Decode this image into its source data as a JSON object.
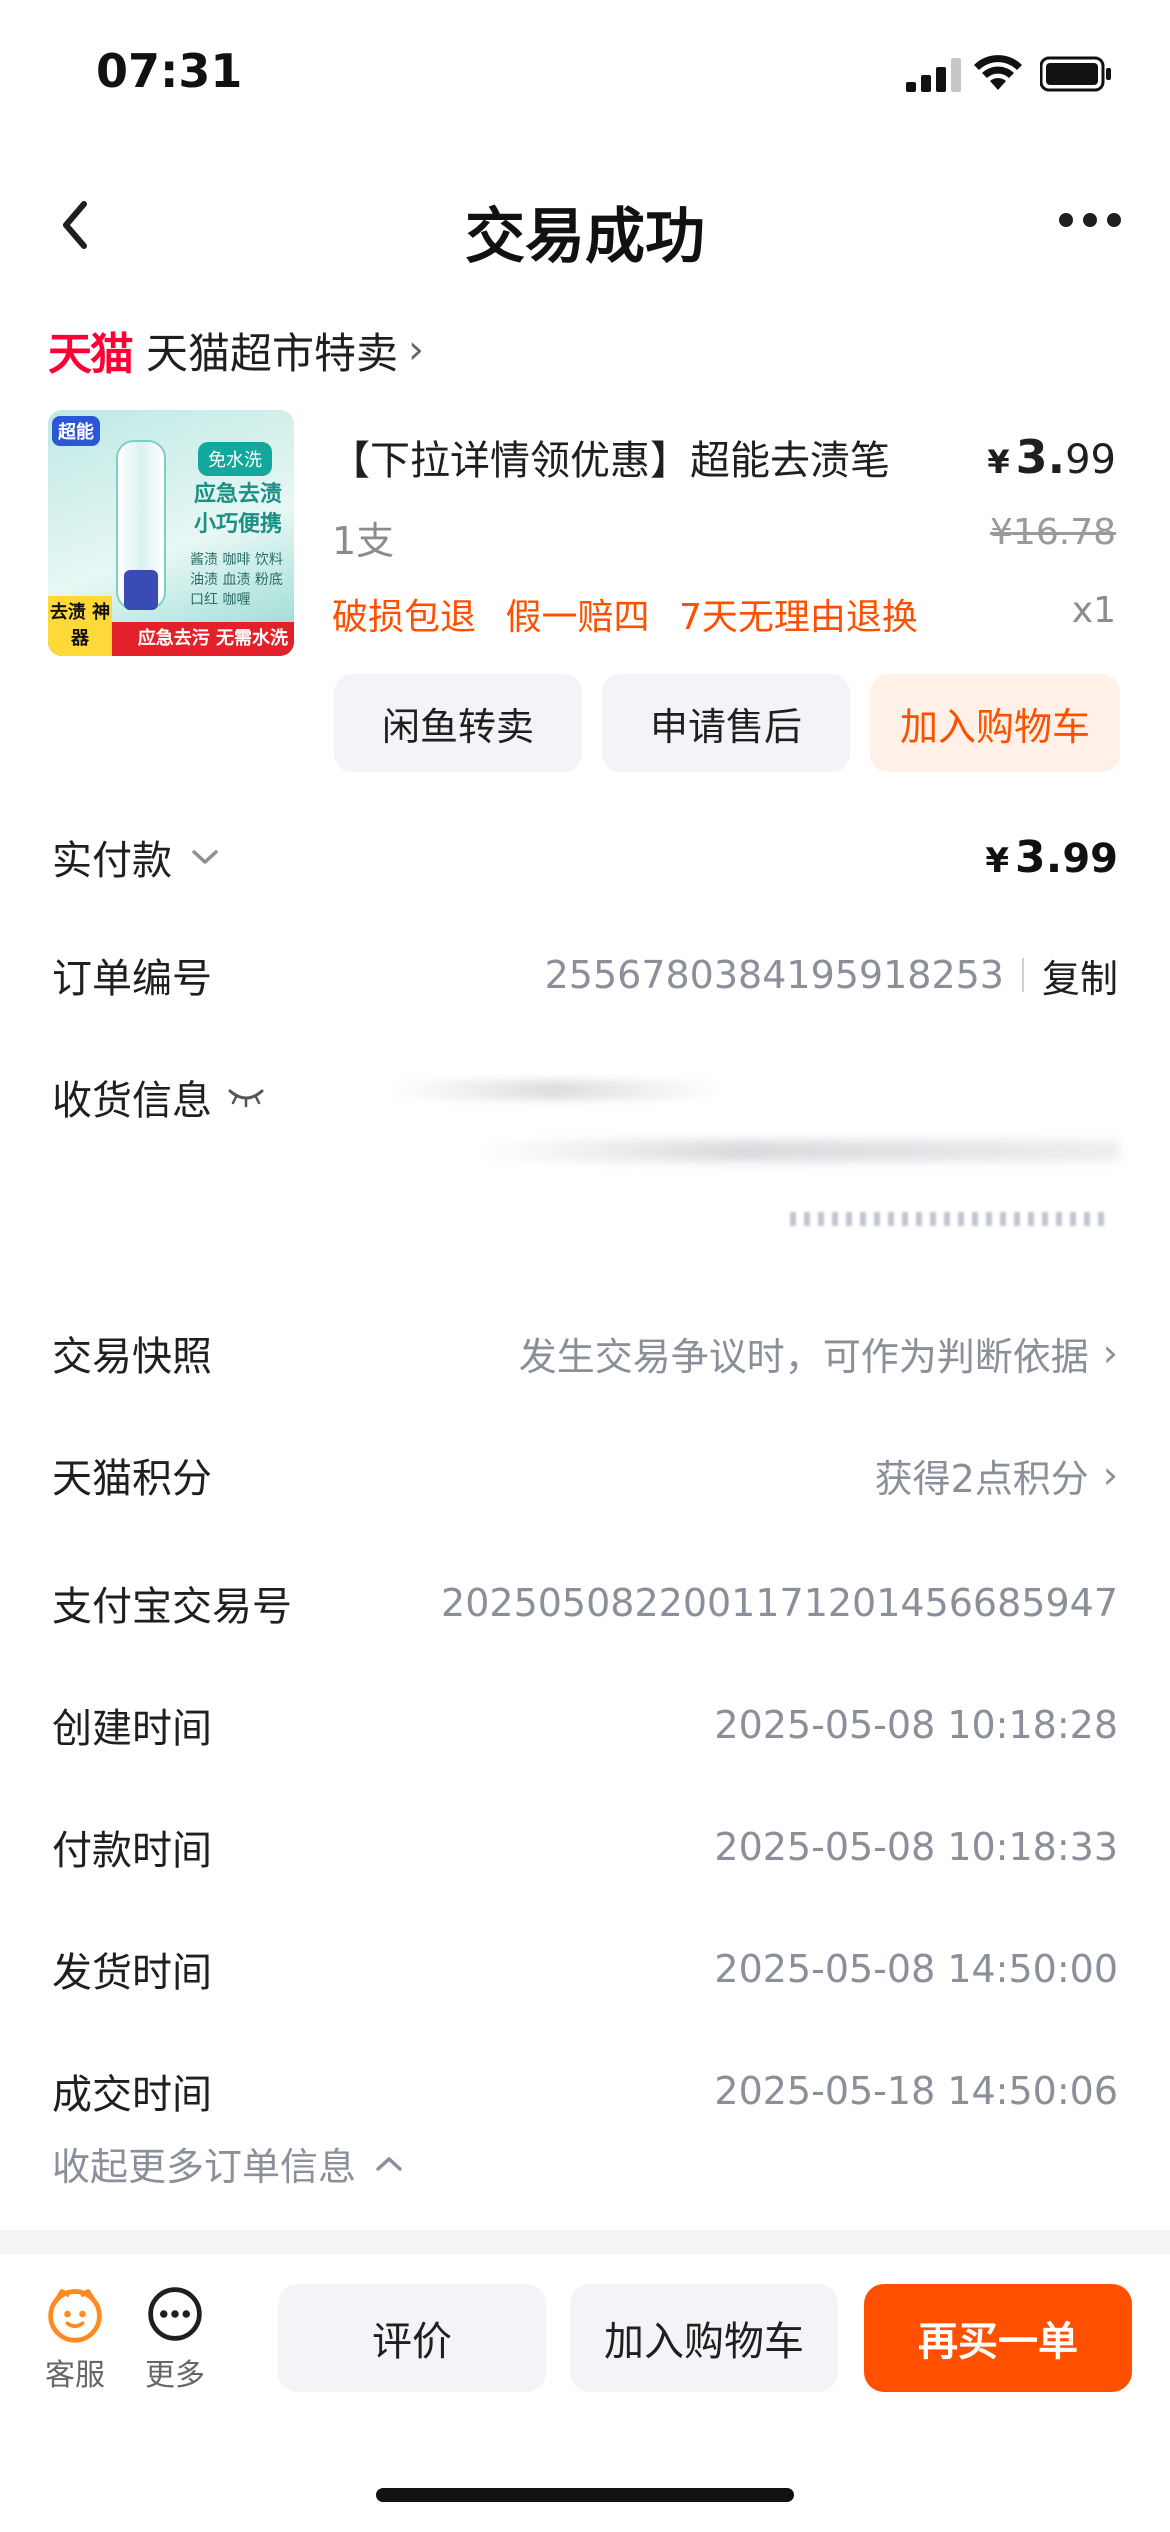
{
  "status_bar": {
    "time": "07:31"
  },
  "nav": {
    "title": "交易成功"
  },
  "shop": {
    "logo": "天猫",
    "name": "天猫超市特卖"
  },
  "product": {
    "image": {
      "brand": "超能",
      "badge": "免水洗",
      "title": "应急去渍 小巧便携",
      "list": "酱渍 咖啡 饮料 油渍 血渍 粉底 口红 咖喱",
      "tag": "去渍 神器",
      "banner": "应急去污 无需水洗"
    },
    "title": "【下拉详情领优惠】超能去渍笔",
    "price_yen": "¥",
    "price_int": "3.",
    "price_dec": "99",
    "spec": "1支",
    "original_price": "¥16.78",
    "services": [
      "破损包退",
      "假一赔四",
      "7天无理由退换"
    ],
    "quantity": "x1"
  },
  "actions": {
    "resell": "闲鱼转卖",
    "aftersale": "申请售后",
    "add_cart": "加入购物车"
  },
  "details": {
    "paid_label": "实付款",
    "paid_yen": "¥",
    "paid_int": "3.",
    "paid_dec": "99",
    "order_no_label": "订单编号",
    "order_no": "2556780384195918253",
    "copy": "复制",
    "shipping_label": "收货信息",
    "snapshot_label": "交易快照",
    "snapshot_value": "发生交易争议时，可作为判断依据",
    "points_label": "天猫积分",
    "points_value": "获得2点积分",
    "alipay_label": "支付宝交易号",
    "alipay_value": "2025050822001171201456685947",
    "created_label": "创建时间",
    "created_value": "2025-05-08 10:18:28",
    "paid_time_label": "付款时间",
    "paid_time_value": "2025-05-08 10:18:33",
    "shipped_label": "发货时间",
    "shipped_value": "2025-05-08 14:50:00",
    "closed_label": "成交时间",
    "closed_value": "2025-05-18 14:50:06",
    "collapse": "收起更多订单信息"
  },
  "bottom": {
    "service": "客服",
    "more": "更多",
    "review": "评价",
    "add_cart": "加入购物车",
    "rebuy": "再买一单"
  },
  "colors": {
    "accent": "#ff5000",
    "tmall_red": "#ff0036"
  }
}
